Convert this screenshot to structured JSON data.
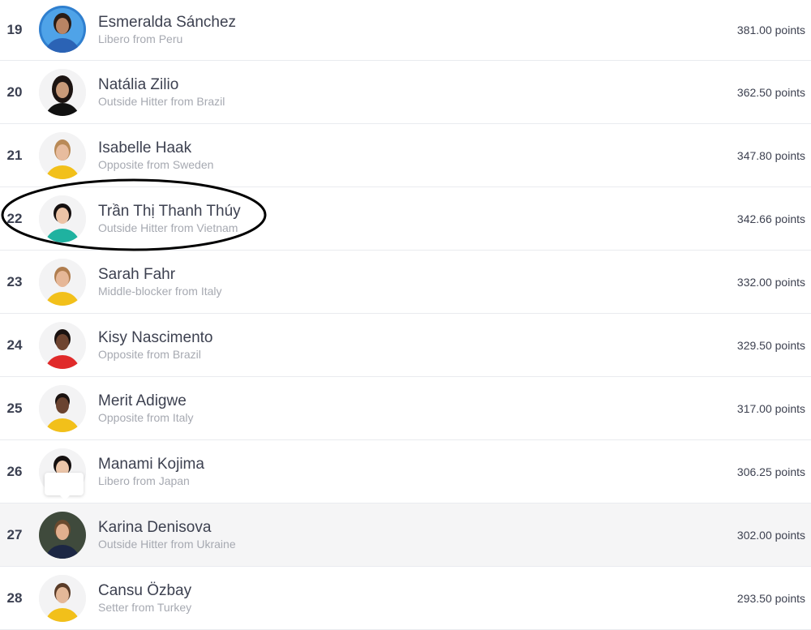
{
  "rankings": [
    {
      "rank": "19",
      "name": "Esmeralda Sánchez",
      "subtitle": "Libero from Peru",
      "points": "381.00 points",
      "jersey_color": "#2b63b5",
      "skin": "#b98463",
      "hair": "#2a1c15"
    },
    {
      "rank": "20",
      "name": "Natália Zilio",
      "subtitle": "Outside Hitter from Brazil",
      "points": "362.50 points",
      "jersey_color": "#111111",
      "skin": "#c99a79",
      "hair": "#1c1412"
    },
    {
      "rank": "21",
      "name": "Isabelle Haak",
      "subtitle": "Opposite from Sweden",
      "points": "347.80 points",
      "jersey_color": "#f2c01a",
      "skin": "#e7bc9e",
      "hair": "#b98a57"
    },
    {
      "rank": "22",
      "name": "Trần Thị Thanh Thúy",
      "subtitle": "Outside Hitter from Vietnam",
      "points": "342.66 points",
      "jersey_color": "#1fb2a0",
      "skin": "#ecc3a6",
      "hair": "#151010"
    },
    {
      "rank": "23",
      "name": "Sarah Fahr",
      "subtitle": "Middle-blocker from Italy",
      "points": "332.00 points",
      "jersey_color": "#f2c01a",
      "skin": "#e6b797",
      "hair": "#b07d4e"
    },
    {
      "rank": "24",
      "name": "Kisy Nascimento",
      "subtitle": "Opposite from Brazil",
      "points": "329.50 points",
      "jersey_color": "#e02a2a",
      "skin": "#6e4430",
      "hair": "#1a1210"
    },
    {
      "rank": "25",
      "name": "Merit Adigwe",
      "subtitle": "Opposite from Italy",
      "points": "317.00 points",
      "jersey_color": "#f2c01a",
      "skin": "#6a4330",
      "hair": "#1a1210"
    },
    {
      "rank": "26",
      "name": "Manami Kojima",
      "subtitle": "Libero from Japan",
      "points": "306.25 points",
      "jersey_color": "#f1f1f1",
      "skin": "#ecc6aa",
      "hair": "#151010"
    },
    {
      "rank": "27",
      "name": "Karina Denisova",
      "subtitle": "Outside Hitter from Ukraine",
      "points": "302.00 points",
      "jersey_color": "#1c2744",
      "skin": "#e2b08f",
      "hair": "#6b4a2e"
    },
    {
      "rank": "28",
      "name": "Cansu Özbay",
      "subtitle": "Setter from Turkey",
      "points": "293.50 points",
      "jersey_color": "#f2c01a",
      "skin": "#e4b898",
      "hair": "#5a3c28"
    }
  ],
  "annotation": {
    "type": "hand-drawn ellipse",
    "highlighted_rank": "22",
    "color": "#000000"
  }
}
